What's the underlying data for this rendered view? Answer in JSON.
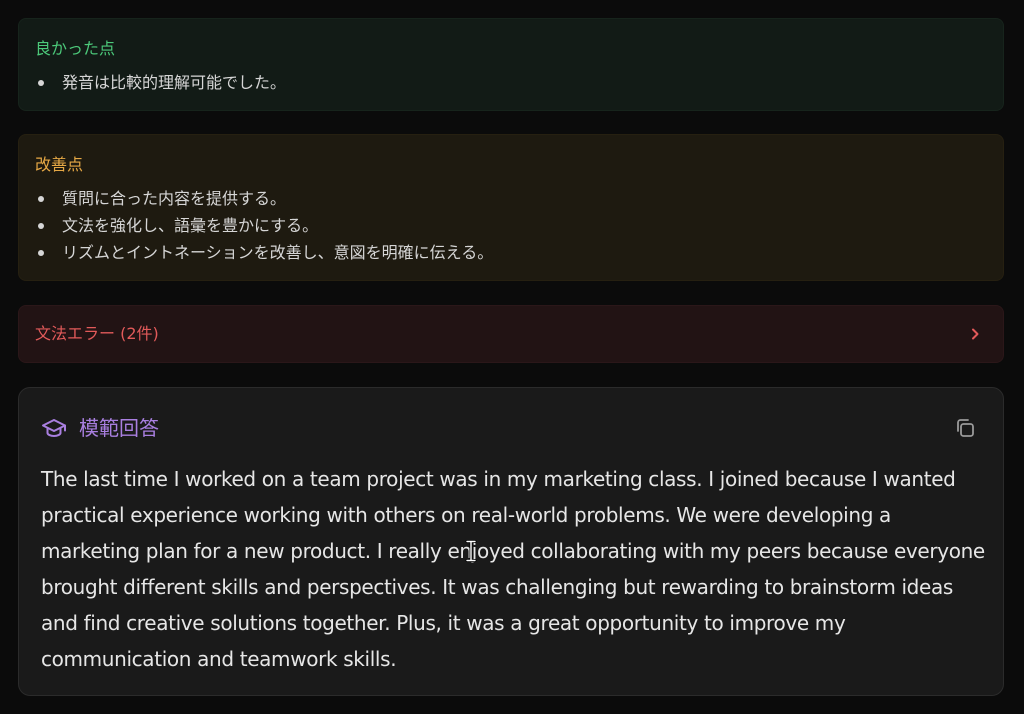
{
  "good_points": {
    "title": "良かった点",
    "items": [
      "発音は比較的理解可能でした。"
    ]
  },
  "improvements": {
    "title": "改善点",
    "items": [
      "質問に合った内容を提供する。",
      "文法を強化し、語彙を豊かにする。",
      "リズムとイントネーションを改善し、意図を明確に伝える。"
    ]
  },
  "grammar_errors": {
    "label": "文法エラー (2件)",
    "icon": "chevron-right-icon"
  },
  "model_answer": {
    "title": "模範回答",
    "title_icon": "graduation-cap-icon",
    "copy_icon": "copy-icon",
    "text": "The last time I worked on a team project was in my marketing class. I joined because I wanted practical experience working with others on real-world problems. We were developing a marketing plan for a new product. I really enjoyed collaborating with my peers because everyone brought different skills and perspectives. It was challenging but rewarding to brainstorm ideas and find creative solutions together. Plus, it was a great opportunity to improve my communication and teamwork skills."
  },
  "colors": {
    "good": "#4cc97a",
    "improve": "#e6a845",
    "error": "#e25a5a",
    "accent": "#a97fe0"
  }
}
